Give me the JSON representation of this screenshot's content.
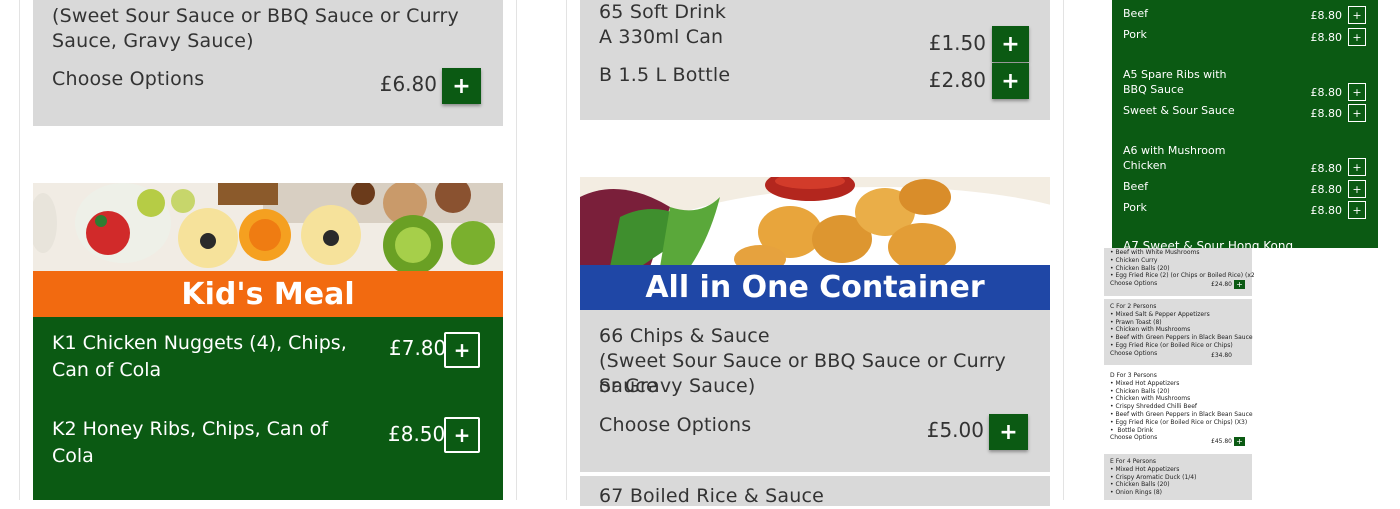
{
  "col1": {
    "top_item": {
      "desc_lines": [
        "(Sweet Sour Sauce or BBQ Sauce or Curry",
        "Sauce, Gravy Sauce)"
      ],
      "options_label": "Choose Options",
      "price": "£6.80",
      "add": "+"
    },
    "kids_meal": {
      "title": "Kid's Meal",
      "items": [
        {
          "name_lines": [
            "K1 Chicken Nuggets (4), Chips,",
            "Can of Cola"
          ],
          "price": "£7.80",
          "add": "+"
        },
        {
          "name_lines": [
            "K2 Honey Ribs, Chips, Can of",
            "Cola"
          ],
          "price": "£8.50",
          "add": "+"
        }
      ]
    }
  },
  "col2": {
    "soft_drink": {
      "title": "65 Soft Drink",
      "options": [
        {
          "label": "A 330ml Can",
          "price": "£1.50",
          "add": "+"
        },
        {
          "label": "B 1.5 L Bottle",
          "price": "£2.80",
          "add": "+"
        }
      ]
    },
    "container": {
      "title": "All in One Container",
      "item": {
        "name_lines": [
          "66 Chips & Sauce",
          "(Sweet Sour Sauce or BBQ Sauce or Curry Sauce",
          "or Gravy Sauce)"
        ],
        "options_label": "Choose Options",
        "price": "£5.00",
        "add": "+"
      },
      "next_item": "67 Boiled Rice & Sauce"
    }
  },
  "side_menu": {
    "rows": [
      {
        "label": "Beef",
        "price": "£8.80",
        "add": "+"
      },
      {
        "label": "Pork",
        "price": "£8.80",
        "add": "+"
      },
      {
        "label": "A5 Spare Ribs with",
        "label2": "BBQ Sauce",
        "price": "£8.80",
        "add": "+"
      },
      {
        "label": "Sweet & Sour Sauce",
        "price": "£8.80",
        "add": "+"
      },
      {
        "label": "A6 with Mushroom",
        "label2": "Chicken",
        "price": "£8.80",
        "add": "+"
      },
      {
        "label": "Beef",
        "price": "£8.80",
        "add": "+"
      },
      {
        "label": "Pork",
        "price": "£8.80",
        "add": "+"
      }
    ],
    "cut_label": "A7 Sweet & Sour Hong Kong"
  },
  "side_sets": [
    {
      "text": "• Beef with White Mushrooms\n• Chicken Curry\n• Chicken Balls (20)\n• Egg Fried Rice (2) (or Chips or Boiled Rice) (x2)\nChoose Options",
      "price": "£24.80"
    },
    {
      "text": "C For 2 Persons\n• Mixed Salt & Pepper Appetizers\n• Prawn Toast (8)\n• Chicken with Mushrooms\n• Beef with Green Peppers in Black Bean Sauce\n• Egg Fried Rice (or Boiled Rice or Chips)\nChoose Options",
      "price": "£34.80"
    },
    {
      "text": "D For 3 Persons\n• Mixed Hot Appetizers\n• Chicken Balls (20)\n• Chicken with Mushrooms\n• Crispy Shredded Chilli Beef\n• Beef with Green Peppers in Black Bean Sauce\n• Egg Fried Rice (or Boiled Rice or Chips) (X3)\n•  Bottle Drink\nChoose Options",
      "price": "£45.80"
    },
    {
      "text": "E For 4 Persons\n• Mixed Hot Appetizers\n• Crispy Aromatic Duck (1/4)\n• Chicken Balls (20)\n• Onion Rings (8)",
      "price": ""
    }
  ],
  "colors": {
    "green": "#0b5a13",
    "orange": "#f26a10",
    "blue": "#1f47a6",
    "grey": "#d9d9d9"
  }
}
